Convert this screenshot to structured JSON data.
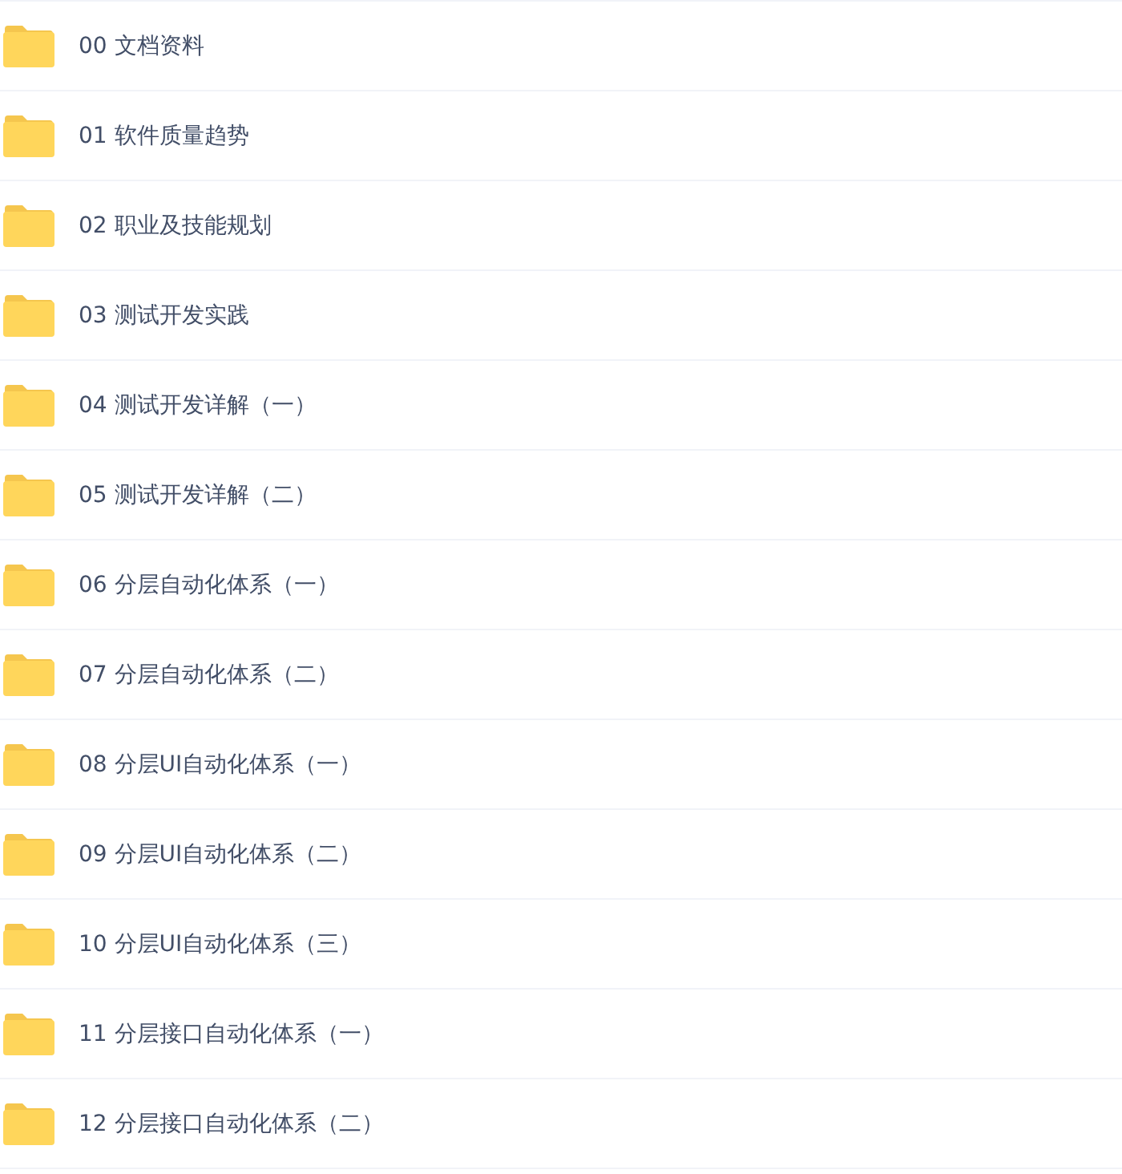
{
  "folders": [
    {
      "name": "00 文档资料"
    },
    {
      "name": "01 软件质量趋势"
    },
    {
      "name": "02 职业及技能规划"
    },
    {
      "name": "03 测试开发实践"
    },
    {
      "name": "04 测试开发详解（一）"
    },
    {
      "name": "05 测试开发详解（二）"
    },
    {
      "name": "06 分层自动化体系（一）"
    },
    {
      "name": "07 分层自动化体系（二）"
    },
    {
      "name": "08 分层UI自动化体系（一）"
    },
    {
      "name": "09 分层UI自动化体系（二）"
    },
    {
      "name": "10 分层UI自动化体系（三）"
    },
    {
      "name": "11 分层接口自动化体系（一）"
    },
    {
      "name": "12 分层接口自动化体系（二）"
    }
  ]
}
